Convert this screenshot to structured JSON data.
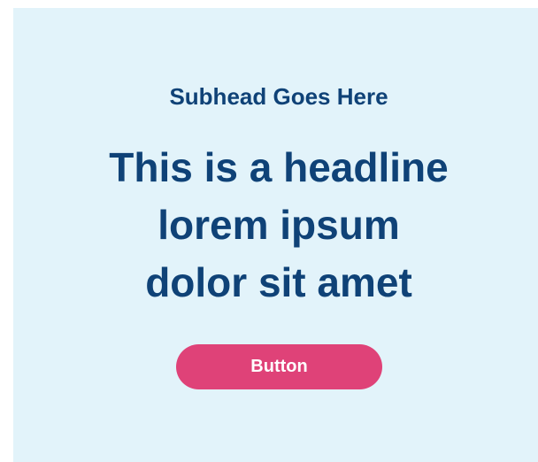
{
  "hero": {
    "subhead": "Subhead Goes Here",
    "headline_lines": [
      "This is a headline",
      "lorem ipsum",
      "dolor sit amet"
    ],
    "button_label": "Button"
  },
  "colors": {
    "background": "#e2f3fa",
    "text": "#0f4277",
    "button": "#df4278",
    "button_text": "#ffffff"
  }
}
